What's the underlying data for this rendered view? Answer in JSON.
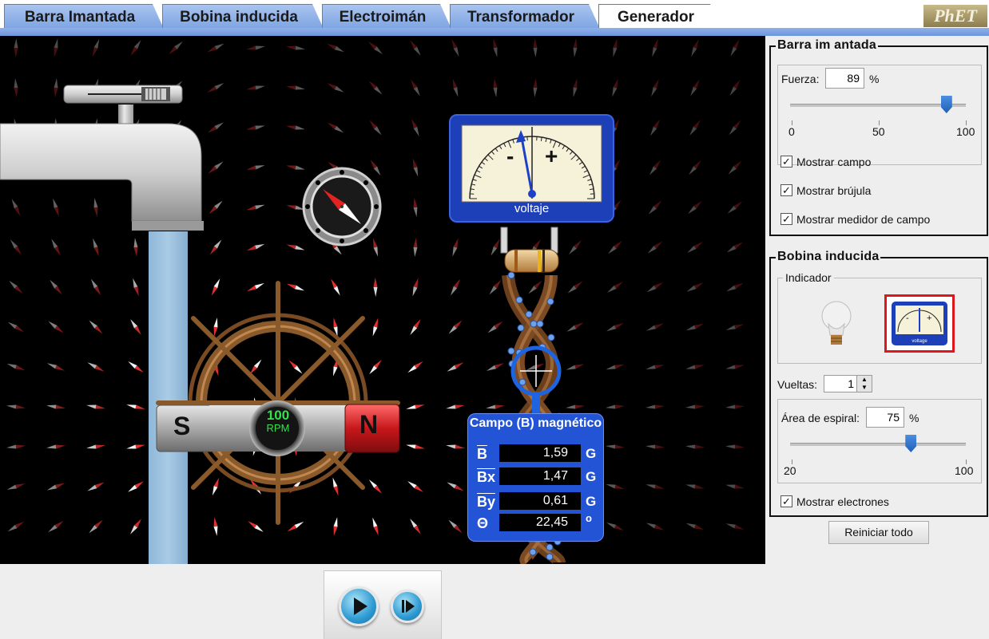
{
  "tabs": [
    {
      "label": "Barra Imantada",
      "active": false
    },
    {
      "label": "Bobina inducida",
      "active": false
    },
    {
      "label": "Electroimán",
      "active": false
    },
    {
      "label": "Transformador",
      "active": false
    },
    {
      "label": "Generador",
      "active": true
    }
  ],
  "logo": "PhET",
  "wheel": {
    "rpm_value": "100",
    "rpm_unit": "RPM"
  },
  "magnet": {
    "south": "S",
    "north": "N"
  },
  "voltmeter": {
    "label": "voltaje",
    "minus": "-",
    "plus": "+"
  },
  "field_meter": {
    "title": "Campo (B) magnético",
    "rows": [
      {
        "label": "B",
        "value": "1,59",
        "unit": "G"
      },
      {
        "label": "Bx",
        "value": "1,47",
        "unit": "G"
      },
      {
        "label": "By",
        "value": "0,61",
        "unit": "G"
      },
      {
        "label": "Θ",
        "value": "22,45",
        "unit": "o"
      }
    ]
  },
  "bar_magnet_panel": {
    "title": "Barra im antada",
    "strength_label": "Fuerza:",
    "strength_value": "89",
    "strength_unit": "%",
    "slider_min": "0",
    "slider_mid": "50",
    "slider_max": "100",
    "strength_fraction": 0.89,
    "show_field": "Mostrar campo",
    "show_compass": "Mostrar brújula",
    "show_field_meter": "Mostrar medidor de campo",
    "show_field_checked": true,
    "show_compass_checked": true,
    "show_field_meter_checked": true
  },
  "pickup_coil_panel": {
    "title": "Bobina inducida",
    "indicator_label": "Indicador",
    "indicator_selected": "voltmeter",
    "voltmeter_icon_label": "voltage",
    "loops_label": "Vueltas:",
    "loops_value": "1",
    "area_label": "Área de espiral:",
    "area_value": "75",
    "area_unit": "%",
    "area_min": "20",
    "area_max": "100",
    "area_fraction": 0.6875,
    "show_electrons": "Mostrar electrones",
    "show_electrons_checked": true
  },
  "reset_button": "Reiniciar todo",
  "colors": {
    "tab_blue": "#8fb1ea",
    "meter_blue": "#2354d6",
    "north_red": "#c8171b",
    "slider_blue": "#1f5fb8"
  }
}
